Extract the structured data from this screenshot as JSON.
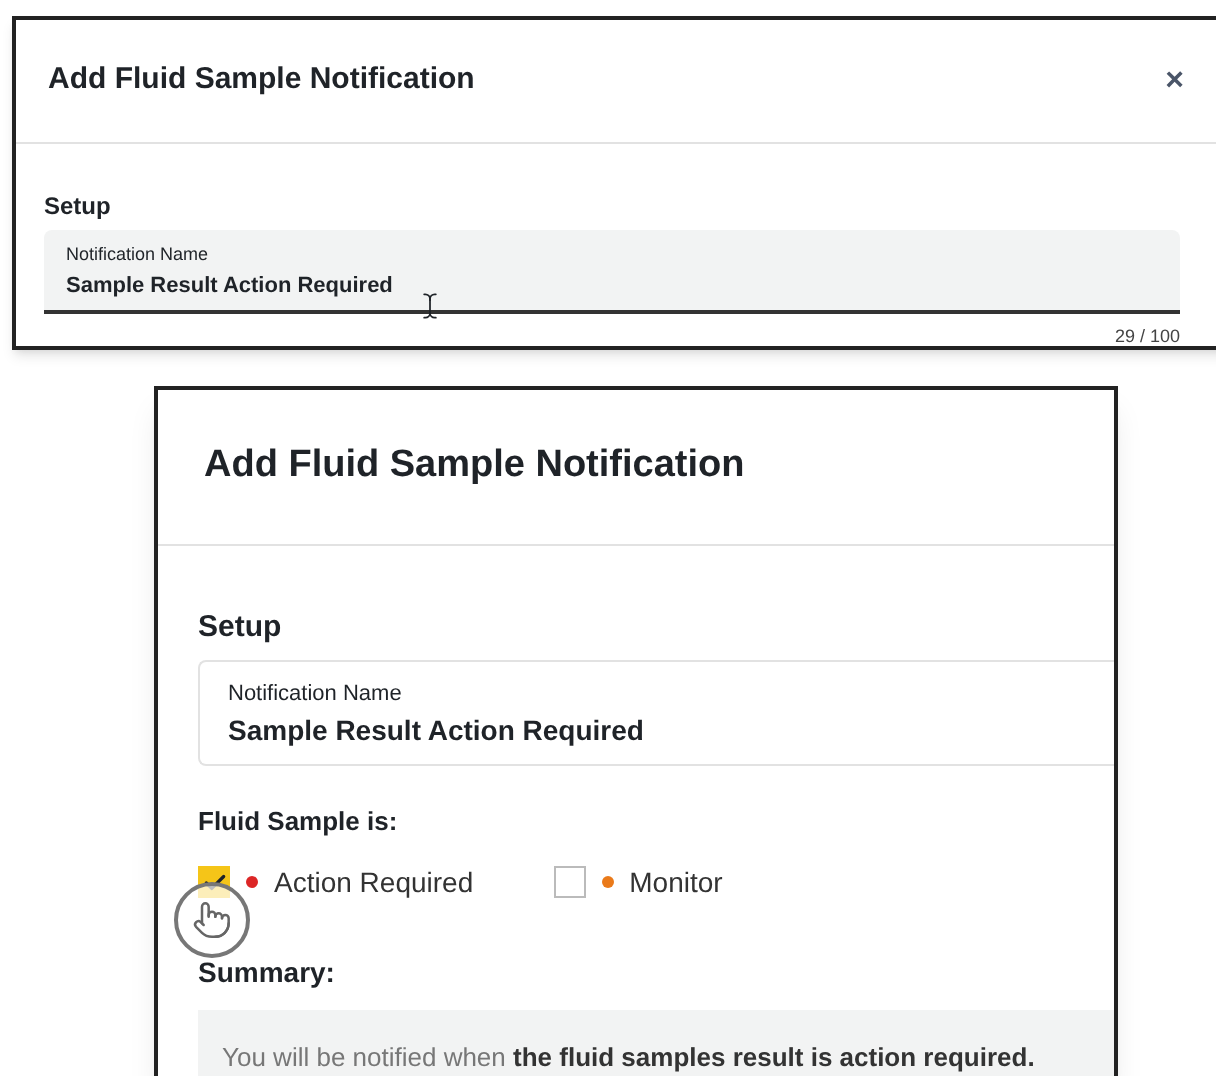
{
  "top_screenshot": {
    "title": "Add Fluid Sample Notification",
    "close": "×",
    "section": "Setup",
    "field": {
      "label": "Notification Name",
      "value": "Sample Result Action Required",
      "counter": "29 / 100"
    }
  },
  "bottom_screenshot": {
    "title": "Add Fluid Sample Notification",
    "section": "Setup",
    "field": {
      "label": "Notification Name",
      "value": "Sample Result Action Required"
    },
    "options_label": "Fluid Sample is:",
    "options": [
      {
        "label": "Action Required",
        "checked": true,
        "color": "#dc2626"
      },
      {
        "label": "Monitor",
        "checked": false,
        "color": "#ea7a1a"
      }
    ],
    "summary_label": "Summary:",
    "summary": "You will be notified when **the fluid samples result is action required.**"
  }
}
